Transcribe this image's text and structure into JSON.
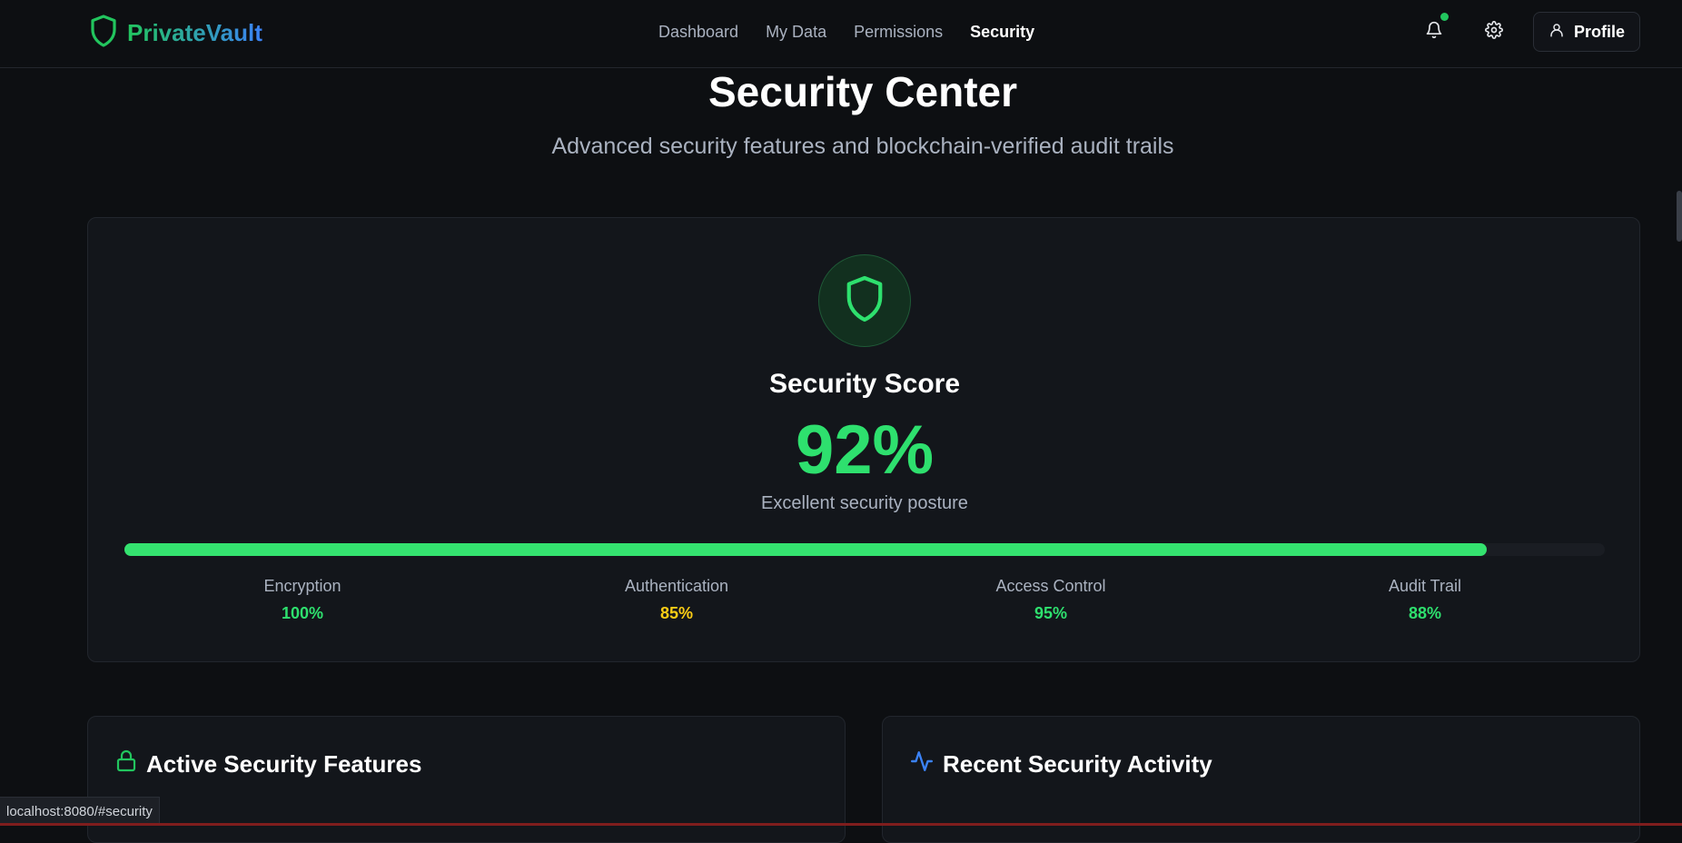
{
  "app": {
    "name": "PrivateVault"
  },
  "nav": {
    "links": [
      "Dashboard",
      "My Data",
      "Permissions",
      "Security"
    ],
    "active": "Security",
    "profile_label": "Profile"
  },
  "header": {
    "title": "Security Center",
    "subtitle": "Advanced security features and blockchain-verified audit trails"
  },
  "score": {
    "label": "Security Score",
    "value": "92%",
    "value_fraction": 0.92,
    "description": "Excellent security posture",
    "metrics": [
      {
        "label": "Encryption",
        "value": "100%",
        "color": "#2ee06e"
      },
      {
        "label": "Authentication",
        "value": "85%",
        "color": "#facc15"
      },
      {
        "label": "Access Control",
        "value": "95%",
        "color": "#2ee06e"
      },
      {
        "label": "Audit Trail",
        "value": "88%",
        "color": "#2ee06e"
      }
    ]
  },
  "panels": {
    "features_title": "Active Security Features",
    "activity_title": "Recent Security Activity"
  },
  "status_bar": {
    "url": "localhost:8080/#security"
  },
  "colors": {
    "accent": "#22c55e",
    "brand_gradient_end": "#3b82f6",
    "warning": "#facc15",
    "activity_icon": "#3b82f6"
  },
  "icons": [
    "shield-icon",
    "bell-icon",
    "gear-icon",
    "user-icon",
    "lock-icon",
    "activity-icon"
  ]
}
